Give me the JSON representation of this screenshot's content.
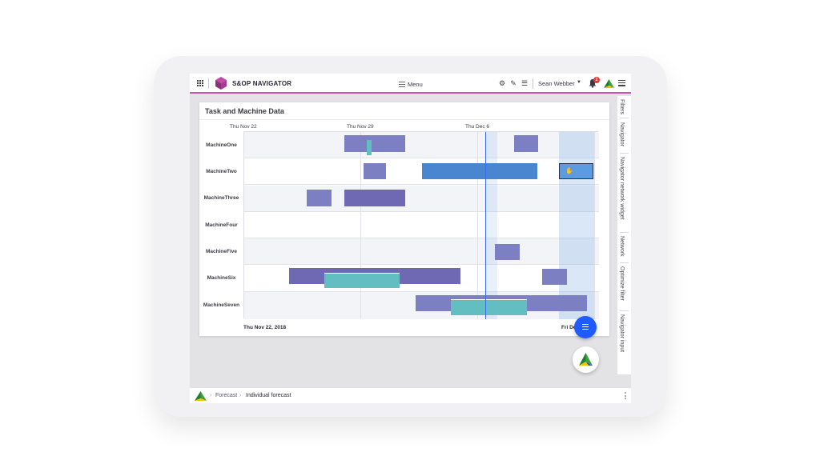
{
  "app": {
    "title": "S&OP NAVIGATOR"
  },
  "header": {
    "menu_label": "Menu",
    "user_name": "Sean Webber",
    "notification_count": "2"
  },
  "panel": {
    "title": "Task and Machine Data",
    "date_labels": [
      "Thu Nov 22",
      "Thu Nov 29",
      "Thu Dec 6"
    ],
    "footer_start": "Thu Nov 22, 2018",
    "footer_end": "Fri De"
  },
  "machines": [
    "MachineOne",
    "MachineTwo",
    "MachineThree",
    "MachineFour",
    "MachineFive",
    "MachineSix",
    "MachineSeven"
  ],
  "side_tabs": [
    "Filters",
    "Navigator",
    "Navigator network widget",
    "Network",
    "Optimize filter",
    "Navigator input"
  ],
  "breadcrumb": {
    "items": [
      "Forecast",
      "Individual forecast"
    ]
  },
  "colors": {
    "accent_line": "#d34fa9",
    "task_purple": "#7c80c2",
    "task_dark_purple": "#6f68b2",
    "task_blue": "#4a86cf",
    "task_teal": "#62bec0",
    "today_line": "#3a6cf0",
    "fab_blue": "#1f5bff"
  },
  "icons": {
    "apps": "apps-grid-icon",
    "settings": "gear-icon",
    "edit": "pencil-icon",
    "list": "list-icon",
    "user_menu": "caret-down-icon",
    "notifications": "bell-icon",
    "brand": "brand-triangle-icon",
    "settings_menu": "sliders-icon",
    "fab": "menu-icon"
  }
}
